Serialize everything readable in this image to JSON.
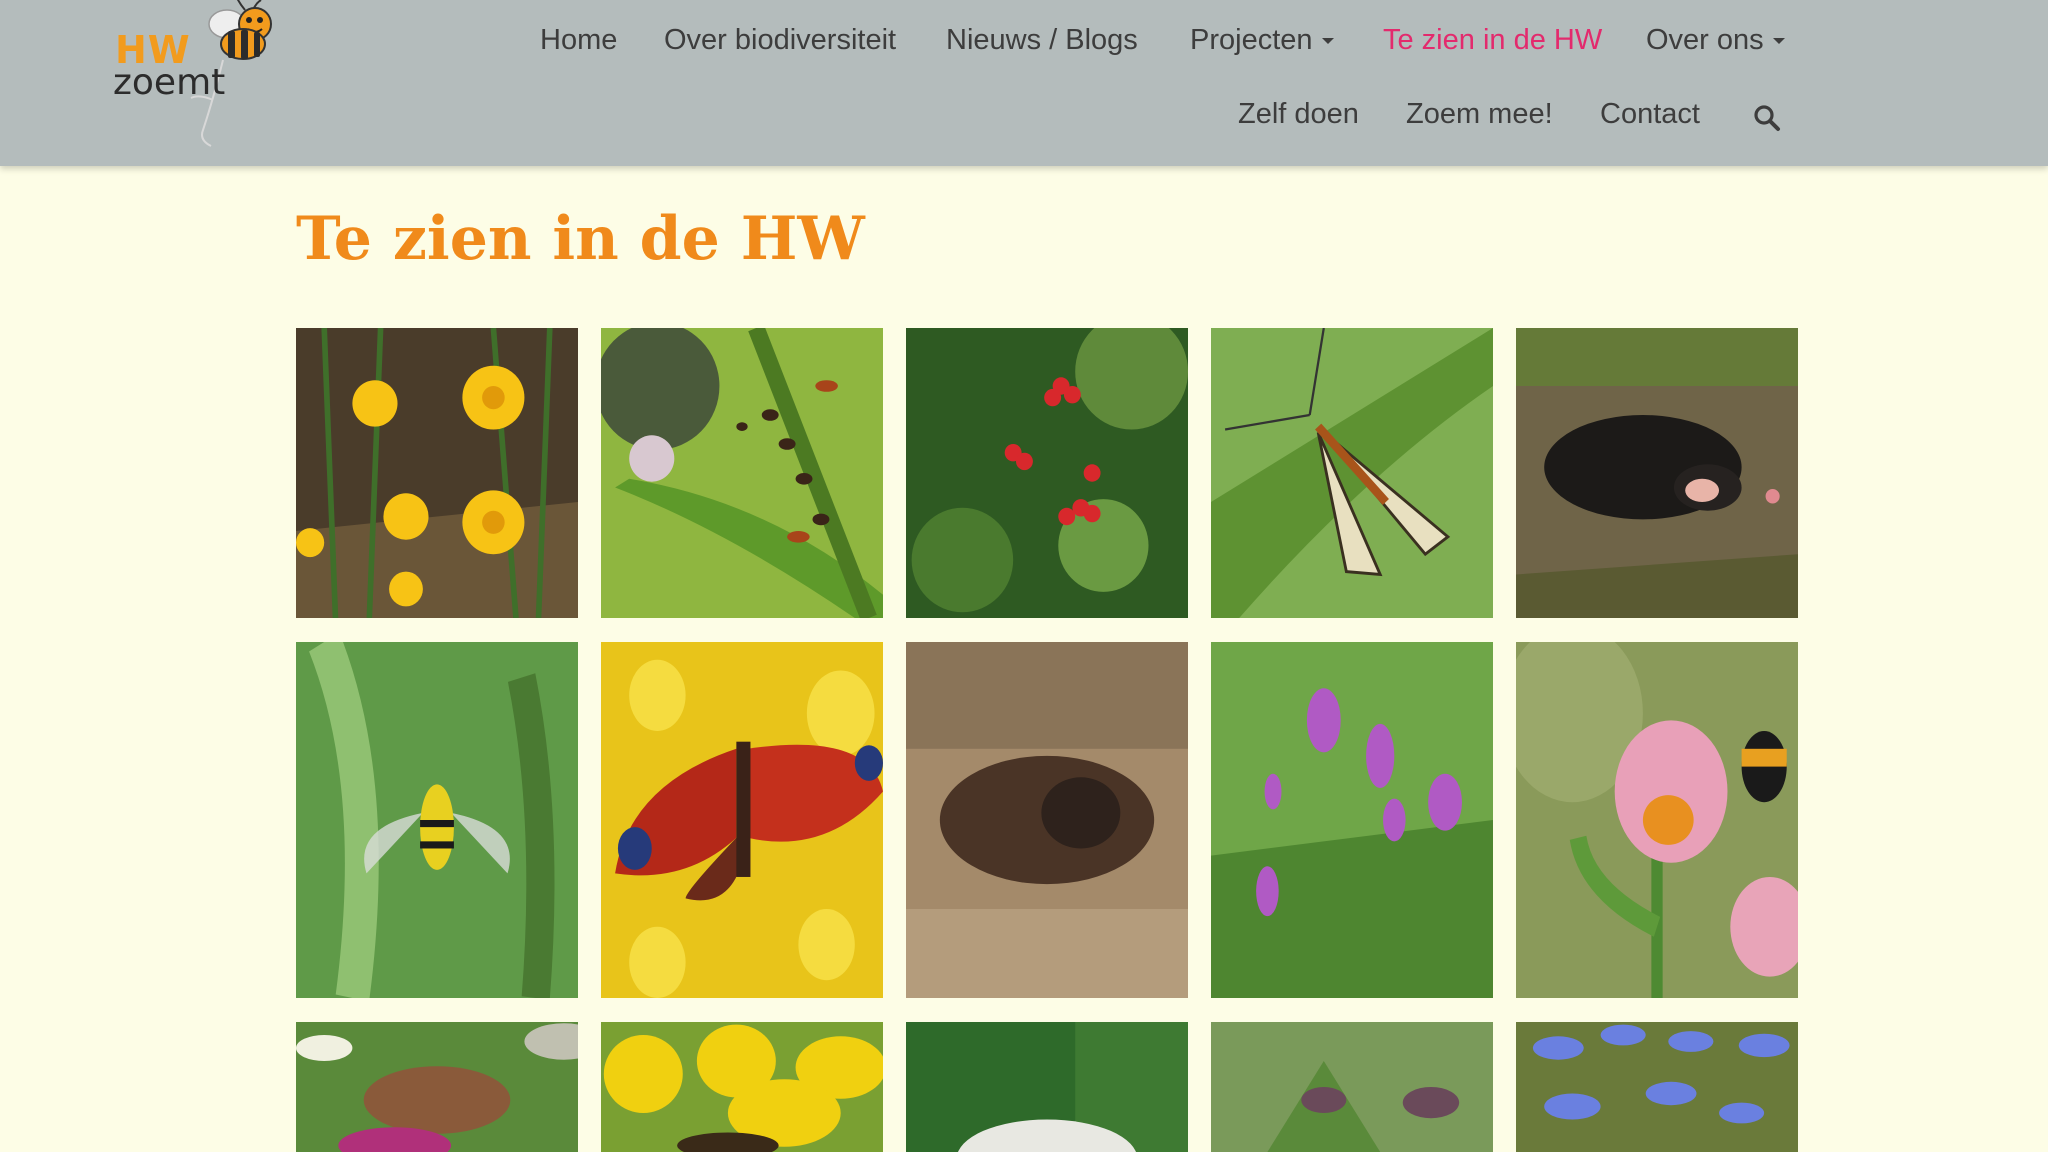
{
  "logo": {
    "line1": "HW",
    "line2": "zoemt"
  },
  "nav": {
    "row1": [
      {
        "label": "Home",
        "dropdown": false,
        "active": false
      },
      {
        "label": "Over biodiversiteit",
        "dropdown": false,
        "active": false
      },
      {
        "label": "Nieuws / Blogs",
        "dropdown": false,
        "active": false
      },
      {
        "label": "Projecten",
        "dropdown": true,
        "active": false
      },
      {
        "label": "Te zien in de HW",
        "dropdown": false,
        "active": true
      },
      {
        "label": "Over ons",
        "dropdown": true,
        "active": false
      }
    ],
    "row2": [
      {
        "label": "Zelf doen"
      },
      {
        "label": "Zoem mee!"
      },
      {
        "label": "Contact"
      }
    ],
    "search_icon": "search-icon"
  },
  "page": {
    "title": "Te zien in de HW"
  },
  "colors": {
    "navbar_bg": "#b4bcbc",
    "page_bg": "#fdfde6",
    "title": "#f08a1b",
    "active_link": "#e32a6d",
    "link": "#3d3d3d"
  },
  "gallery": [
    {
      "name": "coltsfoot-photo"
    },
    {
      "name": "ants-aphids-thistle-photo"
    },
    {
      "name": "guelder-rose-berries-photo"
    },
    {
      "name": "scorpionfly-photo"
    },
    {
      "name": "mole-photo"
    },
    {
      "name": "hoverfly-thistle-photo"
    },
    {
      "name": "peacock-butterfly-photo"
    },
    {
      "name": "insect-in-sand-photo"
    },
    {
      "name": "orchids-photo"
    },
    {
      "name": "bumblebees-clover-photo"
    },
    {
      "name": "bee-clover-photo"
    },
    {
      "name": "yellow-flower-insect-photo"
    },
    {
      "name": "white-mushroom-photo"
    },
    {
      "name": "comfrey-photo"
    },
    {
      "name": "chicory-flowers-photo"
    }
  ]
}
